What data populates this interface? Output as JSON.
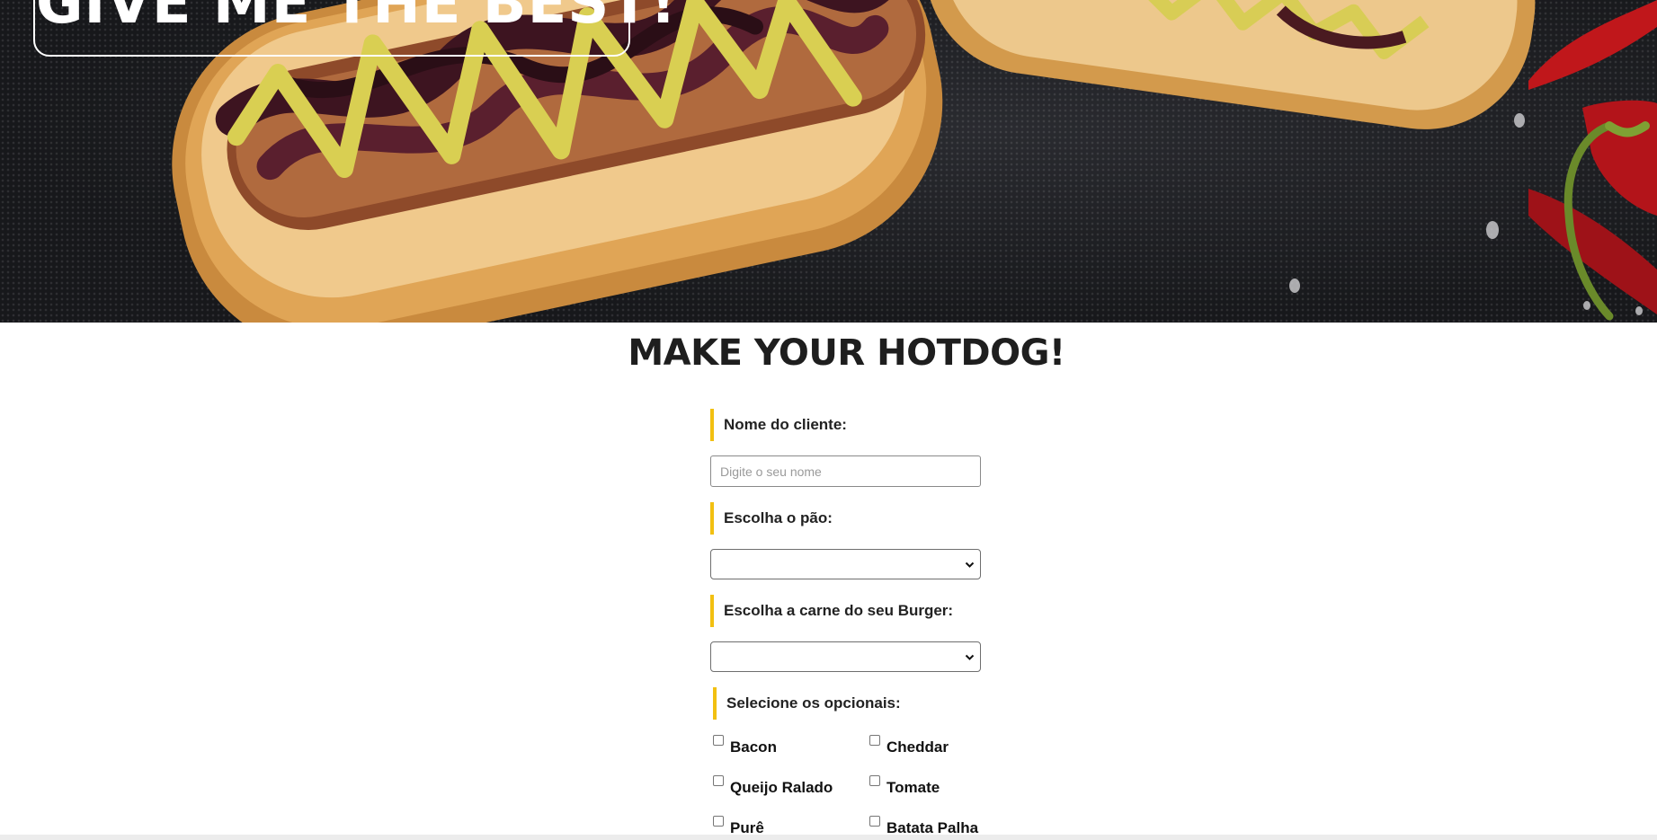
{
  "hero": {
    "title": "GIVE ME THE BEST!",
    "image": "hotdog-hero-photo"
  },
  "page_title": "MAKE YOUR HOTDOG!",
  "form": {
    "name_label": "Nome do cliente:",
    "name_placeholder": "Digite o seu nome",
    "name_value": "",
    "bread_label": "Escolha o pão:",
    "bread_selected": "",
    "meat_label": "Escolha a carne do seu Burger:",
    "meat_selected": "",
    "extras_label": "Selecione os opcionais:",
    "extras": [
      {
        "label": "Bacon",
        "checked": false
      },
      {
        "label": "Cheddar",
        "checked": false
      },
      {
        "label": "Queijo Ralado",
        "checked": false
      },
      {
        "label": "Tomate",
        "checked": false
      },
      {
        "label": "Purê",
        "checked": false
      },
      {
        "label": "Batata Palha",
        "checked": false
      }
    ]
  },
  "colors": {
    "accent": "#f2c011",
    "text_dark": "#1e1e1e",
    "hero_bg": "#1b1c20"
  },
  "icons": {
    "select_arrow": "chevron-down-icon"
  }
}
